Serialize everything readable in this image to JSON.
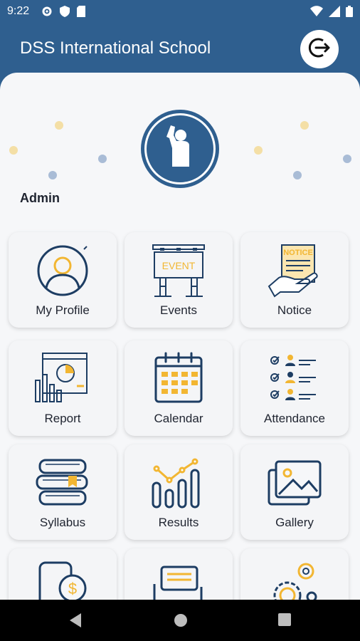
{
  "status": {
    "time": "9:22"
  },
  "appbar": {
    "title": "DSS International School"
  },
  "profile": {
    "name": "Admin"
  },
  "tiles": [
    {
      "label": "My Profile"
    },
    {
      "label": "Events"
    },
    {
      "label": "Notice"
    },
    {
      "label": "Report"
    },
    {
      "label": "Calendar"
    },
    {
      "label": "Attendance"
    },
    {
      "label": "Syllabus"
    },
    {
      "label": "Results"
    },
    {
      "label": "Gallery"
    }
  ],
  "icon_text": {
    "event": "EVENT",
    "notice": "NOTICE"
  },
  "colors": {
    "primary": "#2f5f8f",
    "accent": "#f2b632",
    "background": "#f6f7f9"
  }
}
